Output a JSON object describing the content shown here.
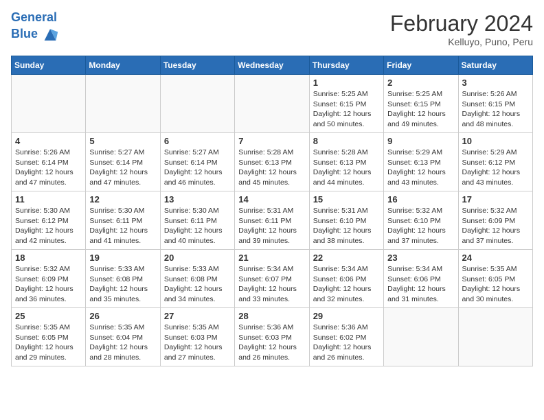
{
  "header": {
    "logo_line1": "General",
    "logo_line2": "Blue",
    "month_year": "February 2024",
    "location": "Kelluyo, Puno, Peru"
  },
  "days_of_week": [
    "Sunday",
    "Monday",
    "Tuesday",
    "Wednesday",
    "Thursday",
    "Friday",
    "Saturday"
  ],
  "weeks": [
    [
      {
        "day": "",
        "info": ""
      },
      {
        "day": "",
        "info": ""
      },
      {
        "day": "",
        "info": ""
      },
      {
        "day": "",
        "info": ""
      },
      {
        "day": "1",
        "info": "Sunrise: 5:25 AM\nSunset: 6:15 PM\nDaylight: 12 hours\nand 50 minutes."
      },
      {
        "day": "2",
        "info": "Sunrise: 5:25 AM\nSunset: 6:15 PM\nDaylight: 12 hours\nand 49 minutes."
      },
      {
        "day": "3",
        "info": "Sunrise: 5:26 AM\nSunset: 6:15 PM\nDaylight: 12 hours\nand 48 minutes."
      }
    ],
    [
      {
        "day": "4",
        "info": "Sunrise: 5:26 AM\nSunset: 6:14 PM\nDaylight: 12 hours\nand 47 minutes."
      },
      {
        "day": "5",
        "info": "Sunrise: 5:27 AM\nSunset: 6:14 PM\nDaylight: 12 hours\nand 47 minutes."
      },
      {
        "day": "6",
        "info": "Sunrise: 5:27 AM\nSunset: 6:14 PM\nDaylight: 12 hours\nand 46 minutes."
      },
      {
        "day": "7",
        "info": "Sunrise: 5:28 AM\nSunset: 6:13 PM\nDaylight: 12 hours\nand 45 minutes."
      },
      {
        "day": "8",
        "info": "Sunrise: 5:28 AM\nSunset: 6:13 PM\nDaylight: 12 hours\nand 44 minutes."
      },
      {
        "day": "9",
        "info": "Sunrise: 5:29 AM\nSunset: 6:13 PM\nDaylight: 12 hours\nand 43 minutes."
      },
      {
        "day": "10",
        "info": "Sunrise: 5:29 AM\nSunset: 6:12 PM\nDaylight: 12 hours\nand 43 minutes."
      }
    ],
    [
      {
        "day": "11",
        "info": "Sunrise: 5:30 AM\nSunset: 6:12 PM\nDaylight: 12 hours\nand 42 minutes."
      },
      {
        "day": "12",
        "info": "Sunrise: 5:30 AM\nSunset: 6:11 PM\nDaylight: 12 hours\nand 41 minutes."
      },
      {
        "day": "13",
        "info": "Sunrise: 5:30 AM\nSunset: 6:11 PM\nDaylight: 12 hours\nand 40 minutes."
      },
      {
        "day": "14",
        "info": "Sunrise: 5:31 AM\nSunset: 6:11 PM\nDaylight: 12 hours\nand 39 minutes."
      },
      {
        "day": "15",
        "info": "Sunrise: 5:31 AM\nSunset: 6:10 PM\nDaylight: 12 hours\nand 38 minutes."
      },
      {
        "day": "16",
        "info": "Sunrise: 5:32 AM\nSunset: 6:10 PM\nDaylight: 12 hours\nand 37 minutes."
      },
      {
        "day": "17",
        "info": "Sunrise: 5:32 AM\nSunset: 6:09 PM\nDaylight: 12 hours\nand 37 minutes."
      }
    ],
    [
      {
        "day": "18",
        "info": "Sunrise: 5:32 AM\nSunset: 6:09 PM\nDaylight: 12 hours\nand 36 minutes."
      },
      {
        "day": "19",
        "info": "Sunrise: 5:33 AM\nSunset: 6:08 PM\nDaylight: 12 hours\nand 35 minutes."
      },
      {
        "day": "20",
        "info": "Sunrise: 5:33 AM\nSunset: 6:08 PM\nDaylight: 12 hours\nand 34 minutes."
      },
      {
        "day": "21",
        "info": "Sunrise: 5:34 AM\nSunset: 6:07 PM\nDaylight: 12 hours\nand 33 minutes."
      },
      {
        "day": "22",
        "info": "Sunrise: 5:34 AM\nSunset: 6:06 PM\nDaylight: 12 hours\nand 32 minutes."
      },
      {
        "day": "23",
        "info": "Sunrise: 5:34 AM\nSunset: 6:06 PM\nDaylight: 12 hours\nand 31 minutes."
      },
      {
        "day": "24",
        "info": "Sunrise: 5:35 AM\nSunset: 6:05 PM\nDaylight: 12 hours\nand 30 minutes."
      }
    ],
    [
      {
        "day": "25",
        "info": "Sunrise: 5:35 AM\nSunset: 6:05 PM\nDaylight: 12 hours\nand 29 minutes."
      },
      {
        "day": "26",
        "info": "Sunrise: 5:35 AM\nSunset: 6:04 PM\nDaylight: 12 hours\nand 28 minutes."
      },
      {
        "day": "27",
        "info": "Sunrise: 5:35 AM\nSunset: 6:03 PM\nDaylight: 12 hours\nand 27 minutes."
      },
      {
        "day": "28",
        "info": "Sunrise: 5:36 AM\nSunset: 6:03 PM\nDaylight: 12 hours\nand 26 minutes."
      },
      {
        "day": "29",
        "info": "Sunrise: 5:36 AM\nSunset: 6:02 PM\nDaylight: 12 hours\nand 26 minutes."
      },
      {
        "day": "",
        "info": ""
      },
      {
        "day": "",
        "info": ""
      }
    ]
  ]
}
